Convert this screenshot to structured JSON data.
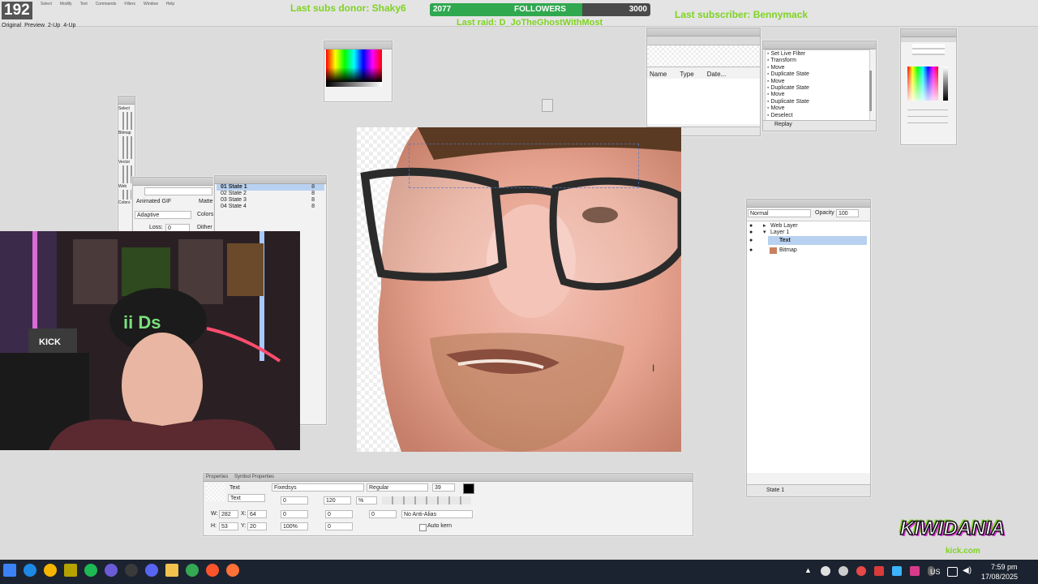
{
  "top": {
    "counter": "192",
    "donor_text": "Last subs donor: Shaky6",
    "followers_current": "2077",
    "followers_label": "FOLLOWERS",
    "followers_goal": "3000",
    "followers_progress": 0.69,
    "subscriber_text": "Last subscriber: Bennymack",
    "raid_text": "Last raid: D_JoTheGhostWithMost",
    "menu": [
      "Select",
      "Modify",
      "Text",
      "Commands",
      "Filters",
      "Window",
      "Help"
    ],
    "view_tabs": [
      "Original",
      "Preview",
      "2-Up",
      "4-Up"
    ]
  },
  "optimize": {
    "format": "Animated GIF",
    "palette": "Adaptive",
    "matte_label": "Matte",
    "colors_label": "Colors",
    "loss_label": "Loss:",
    "loss_value": "0",
    "dither_label": "Dither"
  },
  "states": {
    "items": [
      {
        "name": "01 State 1",
        "delay": "8"
      },
      {
        "name": "02 State 2",
        "delay": "8"
      },
      {
        "name": "03 State 3",
        "delay": "8"
      },
      {
        "name": "04 State 4",
        "delay": "8"
      }
    ]
  },
  "assets": {
    "columns": [
      "Name",
      "Type",
      "Date..."
    ]
  },
  "history": {
    "items": [
      "Set Live Filter",
      "Transform",
      "Move",
      "Duplicate State",
      "Move",
      "Duplicate State",
      "Move",
      "Duplicate State",
      "Move",
      "Deselect"
    ],
    "replay_label": "Replay"
  },
  "layers": {
    "blend_mode": "Normal",
    "opacity_label": "Opacity",
    "opacity_value": "100",
    "items": [
      "Web Layer",
      "Layer 1",
      "Text",
      "Bitmap"
    ],
    "state_label": "State 1"
  },
  "properties": {
    "tab1": "Properties",
    "tab2": "Symbol Properties",
    "type_label": "Text",
    "name_value": "Text",
    "font": "Fixedsys",
    "style": "Regular",
    "size": "39",
    "kerning": "0",
    "leading": "120",
    "leading_unit": "%",
    "w_label": "W:",
    "w_value": "282",
    "x_label": "X:",
    "x_value": "64",
    "h_label": "H:",
    "h_value": "53",
    "y_label": "Y:",
    "y_value": "20",
    "baseline": "0",
    "indent": "0",
    "space_before": "0",
    "scale": "100%",
    "space_after": "0",
    "antialias": "No Anti-Alias",
    "autokern_label": "Auto kern",
    "text_color": "#000000"
  },
  "tools": {
    "sections": [
      "Select",
      "Bitmap",
      "Vector",
      "Web",
      "Colors"
    ]
  },
  "logo": {
    "brand": "KIWIDANIA",
    "site": "kick.com"
  },
  "webcam": {
    "sign_text": "KICK",
    "hat_text": "ii Ds"
  },
  "taskbar": {
    "time": "7:59 pm",
    "date": "17/08/2025",
    "lang": "US",
    "app_icons": [
      "windows-icon",
      "edge-icon",
      "chrome-record-icon",
      "fireworks-icon",
      "spotify-icon",
      "app-icon",
      "obs-icon",
      "discord-icon",
      "file-explorer-icon",
      "chrome-icon",
      "brave-icon",
      "firefox-icon"
    ]
  },
  "colors": {
    "overlay_green": "#7ed321",
    "follow_bar": "#2fa84f",
    "taskbar": "#1c2330",
    "selection": "#b8d1f0"
  }
}
